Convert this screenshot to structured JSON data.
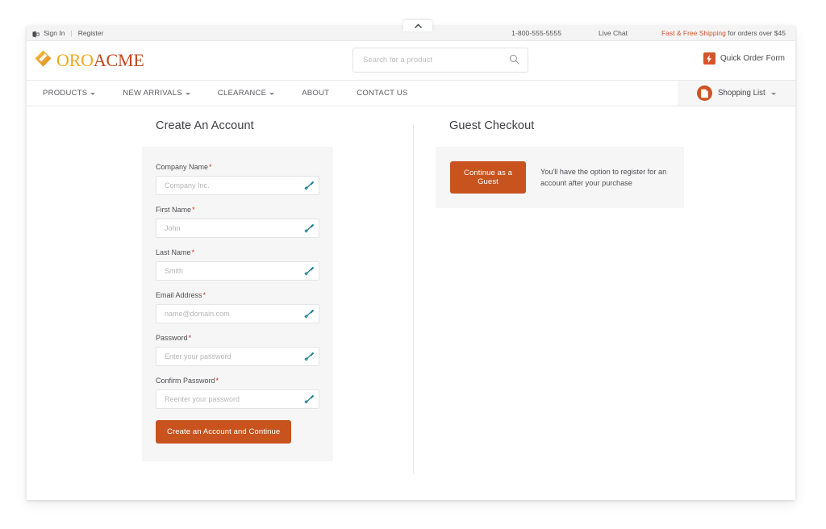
{
  "collapse_tab": {
    "icon": "chevron-up-icon"
  },
  "top_bar": {
    "sign_in": "Sign In",
    "separator": "|",
    "register": "Register",
    "phone": "1-800-555-5555",
    "live_chat": "Live Chat",
    "shipping_accent": "Fast & Free Shipping",
    "shipping_rest": " for orders over $45"
  },
  "header": {
    "logo": {
      "part1": "ORO",
      "part2": "ACME",
      "mark_icon": "oro-diamond-logo-icon"
    },
    "search": {
      "placeholder": "Search for a product",
      "value": "",
      "icon": "search-icon"
    },
    "quick_order": {
      "label": "Quick Order Form",
      "icon": "lightning-bolt-icon"
    }
  },
  "nav": {
    "items": [
      {
        "label": "PRODUCTS",
        "has_caret": true
      },
      {
        "label": "NEW ARRIVALS",
        "has_caret": true
      },
      {
        "label": "CLEARANCE",
        "has_caret": true
      },
      {
        "label": "ABOUT",
        "has_caret": false
      },
      {
        "label": "CONTACT US",
        "has_caret": false
      }
    ],
    "shopping_list": {
      "label": "Shopping List",
      "icon": "shopping-list-document-icon",
      "has_caret": true
    }
  },
  "create_account": {
    "title": "Create An Account",
    "fields": [
      {
        "label": "Company Name",
        "required": "*",
        "placeholder": "Company Inc.",
        "value": "",
        "name": "company-name"
      },
      {
        "label": "First Name",
        "required": "*",
        "placeholder": "John",
        "value": "",
        "name": "first-name"
      },
      {
        "label": "Last Name",
        "required": "*",
        "placeholder": "Smith",
        "value": "",
        "name": "last-name"
      },
      {
        "label": "Email Address",
        "required": "*",
        "placeholder": "name@domain.com",
        "value": "",
        "name": "email-address"
      },
      {
        "label": "Password",
        "required": "*",
        "placeholder": "Enter your password",
        "value": "",
        "name": "password"
      },
      {
        "label": "Confirm Password",
        "required": "*",
        "placeholder": "Reenter your password",
        "value": "",
        "name": "confirm-password"
      }
    ],
    "submit_label": "Create an Account and Continue",
    "field_icon": "autofill-wrench-icon"
  },
  "guest_checkout": {
    "title": "Guest Checkout",
    "button_label": "Continue as a Guest",
    "description": "You'll have the option to register for an account after your purchase"
  },
  "colors": {
    "brand_orange": "#c8531f",
    "logo_gold": "#f0a81e",
    "logo_red": "#c0481f",
    "shipping_accent": "#d4552a",
    "panel_bg": "#f6f6f6",
    "required_red": "#c0392b",
    "autofill_teal": "#1f7f94"
  }
}
